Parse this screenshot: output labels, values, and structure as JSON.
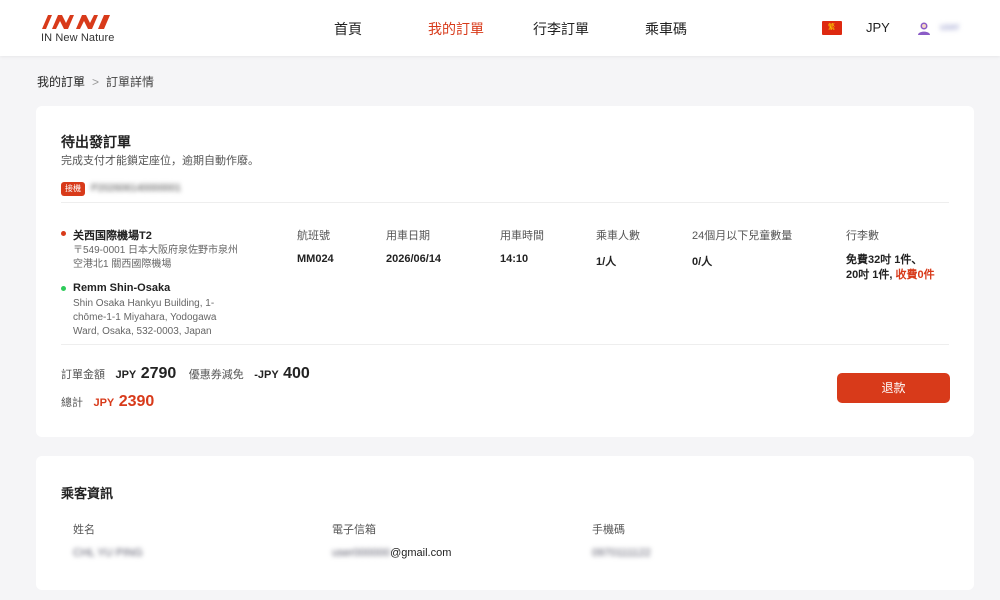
{
  "header": {
    "logo_text": "IN New Nature",
    "nav": [
      "首頁",
      "我的訂單",
      "行李訂單",
      "乘車碼"
    ],
    "active_nav": "我的訂單",
    "language_flag": "繁",
    "currency": "JPY",
    "username": "user"
  },
  "breadcrumb": {
    "parent": "我的訂單",
    "current": "訂單詳情"
  },
  "order": {
    "status_title": "待出發訂單",
    "status_desc": "完成支付才能鎖定座位，逾期自動作廢。",
    "tag": "接機",
    "order_number": "P202606140000001",
    "pickup": {
      "name": "关西国際機場T2",
      "address": "〒549-0001 日本大阪府泉佐野市泉州空港北1 關西國際機場"
    },
    "dropoff": {
      "name": "Remm Shin-Osaka",
      "address": "Shin Osaka Hankyu Building, 1-chōme-1-1 Miyahara, Yodogawa Ward, Osaka, 532-0003, Japan"
    },
    "columns": {
      "flight": {
        "label": "航班號",
        "value": "MM024"
      },
      "date": {
        "label": "用車日期",
        "value": "2026/06/14"
      },
      "time": {
        "label": "用車時間",
        "value": "14:10"
      },
      "passengers": {
        "label": "乘車人數",
        "value": "1/人"
      },
      "children": {
        "label": "24個月以下兒童數量",
        "value": "0/人"
      },
      "luggage": {
        "label": "行李數",
        "line1": "免費32吋 1件、",
        "line2": "20吋 1件,",
        "paid": "收費0件"
      }
    },
    "amount": {
      "order_label": "訂單金額",
      "currency": "JPY",
      "order_value": "2790",
      "coupon_label": "優惠券減免",
      "coupon_currency": "-JPY",
      "coupon_value": "400",
      "total_label": "總計",
      "total_currency": "JPY",
      "total_value": "2390"
    },
    "refund_button": "退款"
  },
  "passenger": {
    "title": "乘客資訊",
    "name_label": "姓名",
    "email_label": "電子信箱",
    "phone_label": "手機碼",
    "name_value": "CHL YU PING",
    "email_prefix": "user000000",
    "email_domain": "@gmail.com",
    "phone_value": "0970111122"
  },
  "colors": {
    "accent": "#d83a1a",
    "green_dot": "#2ecb5a",
    "background": "#f5f5f7"
  }
}
